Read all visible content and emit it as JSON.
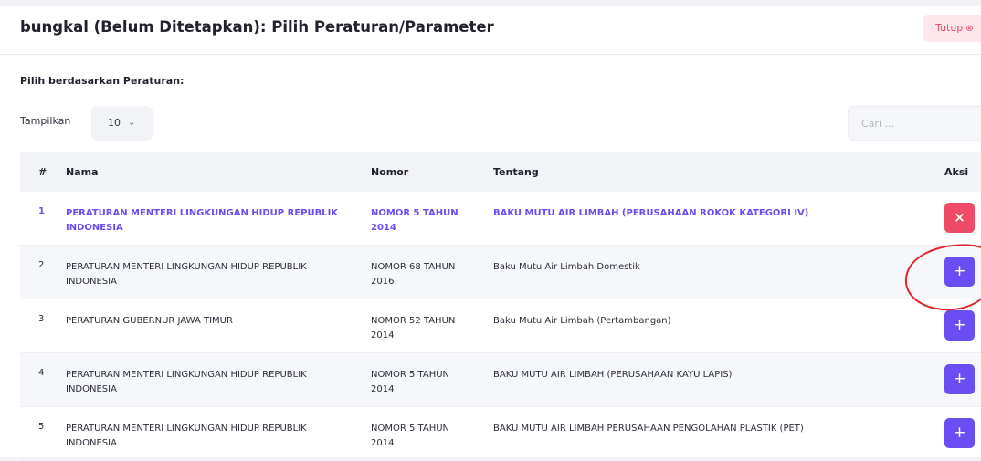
{
  "modal": {
    "title": "bungkal (Belum Ditetapkan): Pilih Peraturan/Parameter",
    "close_label": "Tutup",
    "close_icon": "⊗"
  },
  "filter": {
    "section_label": "Pilih berdasarkan Peraturan:",
    "show_label": "Tampilkan",
    "page_size": "10",
    "search_placeholder": "Cari ..."
  },
  "table": {
    "headers": {
      "num": "#",
      "nama": "Nama",
      "nomor": "Nomor",
      "tentang": "Tentang",
      "aksi": "Aksi"
    },
    "rows": [
      {
        "num": "1",
        "nama": "PERATURAN MENTERI LINGKUNGAN HIDUP REPUBLIK INDONESIA",
        "nomor": "NOMOR 5 TAHUN 2014",
        "tentang": "BAKU MUTU AIR LIMBAH (PERUSAHAAN ROKOK KATEGORI IV)",
        "action": "×"
      },
      {
        "num": "2",
        "nama": "PERATURAN MENTERI LINGKUNGAN HIDUP REPUBLIK INDONESIA",
        "nomor": "NOMOR 68 TAHUN 2016",
        "tentang": "Baku Mutu Air Limbah Domestik",
        "action": "+"
      },
      {
        "num": "3",
        "nama": "PERATURAN GUBERNUR JAWA TIMUR",
        "nomor": "NOMOR 52 TAHUN 2014",
        "tentang": "Baku Mutu Air Limbah (Pertambangan)",
        "action": "+"
      },
      {
        "num": "4",
        "nama": "PERATURAN MENTERI LINGKUNGAN HIDUP REPUBLIK INDONESIA",
        "nomor": "NOMOR 5 TAHUN 2014",
        "tentang": "BAKU MUTU AIR LIMBAH (PERUSAHAAN KAYU LAPIS)",
        "action": "+"
      },
      {
        "num": "5",
        "nama": "PERATURAN MENTERI LINGKUNGAN HIDUP REPUBLIK INDONESIA",
        "nomor": "NOMOR 5 TAHUN 2014",
        "tentang": "BAKU MUTU AIR LIMBAH PERUSAHAAN PENGOLAHAN PLASTIK (PET)",
        "action": "+"
      }
    ]
  },
  "colors": {
    "accent": "#6a4df3",
    "danger": "#ef4a66",
    "annotation": "#e0262f"
  }
}
